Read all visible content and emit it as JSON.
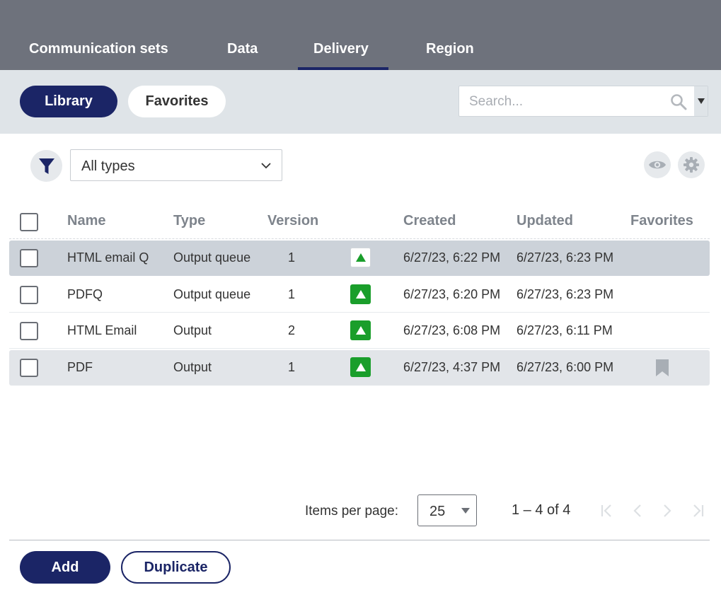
{
  "tabs": [
    {
      "label": "Communication sets"
    },
    {
      "label": "Data"
    },
    {
      "label": "Delivery",
      "active": true
    },
    {
      "label": "Region"
    }
  ],
  "toggle": {
    "library": "Library",
    "favorites": "Favorites",
    "selected": "Library"
  },
  "search": {
    "placeholder": "Search..."
  },
  "filter": {
    "type_value": "All types"
  },
  "table": {
    "columns": [
      "Name",
      "Type",
      "Version",
      "Created",
      "Updated",
      "Favorites"
    ],
    "rows": [
      {
        "name": "HTML email Q",
        "type": "Output queue",
        "version": "1",
        "created": "6/27/23, 6:22 PM",
        "updated": "6/27/23, 6:23 PM",
        "favorite": false,
        "state": "highlighted"
      },
      {
        "name": "PDFQ",
        "type": "Output queue",
        "version": "1",
        "created": "6/27/23, 6:20 PM",
        "updated": "6/27/23, 6:23 PM",
        "favorite": false,
        "state": "normal"
      },
      {
        "name": "HTML Email",
        "type": "Output",
        "version": "2",
        "created": "6/27/23, 6:08 PM",
        "updated": "6/27/23, 6:11 PM",
        "favorite": false,
        "state": "normal"
      },
      {
        "name": "PDF",
        "type": "Output",
        "version": "1",
        "created": "6/27/23, 4:37 PM",
        "updated": "6/27/23, 6:00 PM",
        "favorite": true,
        "state": "hover"
      }
    ]
  },
  "pagination": {
    "items_per_page_label": "Items per page:",
    "items_per_page": "25",
    "range": "1 – 4 of 4"
  },
  "actions": {
    "add": "Add",
    "duplicate": "Duplicate"
  },
  "colors": {
    "brand": "#1b2566",
    "header": "#6e727c",
    "band": "#dfe4e8",
    "status_green": "#1a9e2b"
  }
}
